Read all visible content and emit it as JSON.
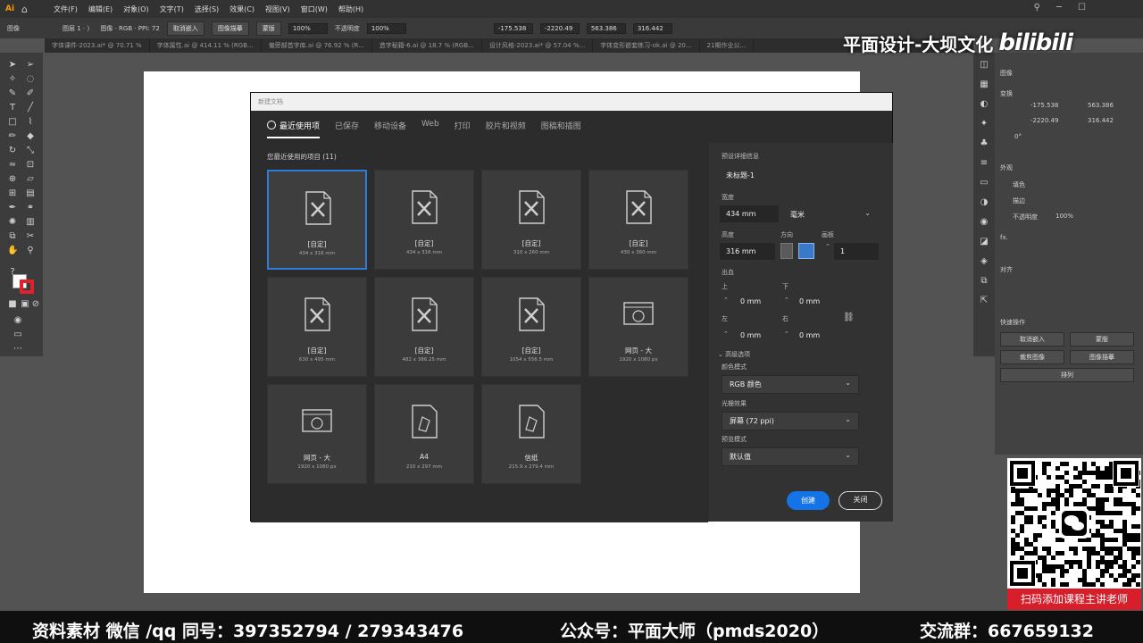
{
  "menubar": {
    "logo": "Ai",
    "items": [
      "文件(F)",
      "编辑(E)",
      "对象(O)",
      "文字(T)",
      "选择(S)",
      "效果(C)",
      "视图(V)",
      "窗口(W)",
      "帮助(H)"
    ]
  },
  "controlbar": {
    "items": [
      "图像",
      "图层 1 · 〉",
      "图像 · RGB · PPI: 72",
      "取消嵌入",
      "图像描摹",
      "蒙版",
      "100%",
      "不透明度",
      "100%",
      "-175.538",
      "-2220.49",
      "563.386",
      "316.442"
    ]
  },
  "doc_tabs": [
    "字体课件-2023.ai* @ 70.71 %",
    "字体属性.ai @ 414.11 % (RGB...",
    "偏旁部首字库.ai @ 76.92 % (R...",
    "造字秘籍-6.ai @ 18.7 % (RGB...",
    "设计风格-2023.ai* @ 57.04 %...",
    "字体变形嵌套练习-ok.ai @ 20...",
    "21期作业公..."
  ],
  "overlay": {
    "title": "平面设计-大坝文化",
    "logo": "bilibili"
  },
  "right_panel": {
    "section_image": "图像",
    "section_transform": "变换",
    "x": "-175.538",
    "y": "-2220.49",
    "w": "563.386",
    "h": "316.442",
    "angle": "0°",
    "section_appearance": "外观",
    "fill": "填色",
    "stroke": "描边",
    "opacity": "不透明度",
    "opacity_val": "100%",
    "fx": "fx.",
    "section_align": "对齐",
    "section_quick": "快速操作",
    "btn_unembed": "取消嵌入",
    "btn_mask": "蒙版",
    "btn_crop": "裁剪图像",
    "btn_trace": "图像描摹",
    "btn_arrange": "排列"
  },
  "dialog": {
    "title": "新建文档",
    "tabs": [
      "最近使用项",
      "已保存",
      "移动设备",
      "Web",
      "打印",
      "胶片和视频",
      "图稿和插图"
    ],
    "recent_label": "您最近使用的项目 (11)",
    "presets": [
      {
        "name": "[自定]",
        "dims": "434 x 316 mm",
        "icon": "custom"
      },
      {
        "name": "[自定]",
        "dims": "434 x 316 mm",
        "icon": "custom"
      },
      {
        "name": "[自定]",
        "dims": "310 x 260 mm",
        "icon": "custom"
      },
      {
        "name": "[自定]",
        "dims": "430 x 360 mm",
        "icon": "custom"
      },
      {
        "name": "[自定]",
        "dims": "630 x 495 mm",
        "icon": "custom"
      },
      {
        "name": "[自定]",
        "dims": "482 x 386.25 mm",
        "icon": "custom"
      },
      {
        "name": "[自定]",
        "dims": "1054 x 556.5 mm",
        "icon": "custom"
      },
      {
        "name": "网页 - 大",
        "dims": "1920 x 1080 px",
        "icon": "web"
      },
      {
        "name": "网页 - 大",
        "dims": "1920 x 1080 px",
        "icon": "web"
      },
      {
        "name": "A4",
        "dims": "210 x 297 mm",
        "icon": "print"
      },
      {
        "name": "信纸",
        "dims": "215.9 x 279.4 mm",
        "icon": "print"
      }
    ],
    "details": {
      "heading": "预设详细信息",
      "doc_name": "未标题-1",
      "width_label": "宽度",
      "width_value": "434 mm",
      "unit": "毫米",
      "height_label": "高度",
      "height_value": "316 mm",
      "orientation_label": "方向",
      "artboards_label": "画板",
      "artboards_value": "1",
      "bleed_label": "出血",
      "top_label": "上",
      "bottom_label": "下",
      "left_label": "左",
      "right_label": "右",
      "top_value": "0 mm",
      "bottom_value": "0 mm",
      "left_value": "0 mm",
      "right_value": "0 mm",
      "advanced_label": "高级选项",
      "color_mode_label": "颜色模式",
      "color_mode_value": "RGB 颜色",
      "raster_label": "光栅效果",
      "raster_value": "屏幕 (72 ppi)",
      "preview_label": "预览模式",
      "preview_value": "默认值"
    },
    "create_label": "创建",
    "close_label": "关闭"
  },
  "qr_caption": "扫码添加课程主讲老师",
  "bottom_banner": {
    "left": "资料素材 微信 /qq 同号：397352794 / 279343476",
    "middle": "公众号：平面大师（pmds2020）",
    "right": "交流群：667659132"
  }
}
